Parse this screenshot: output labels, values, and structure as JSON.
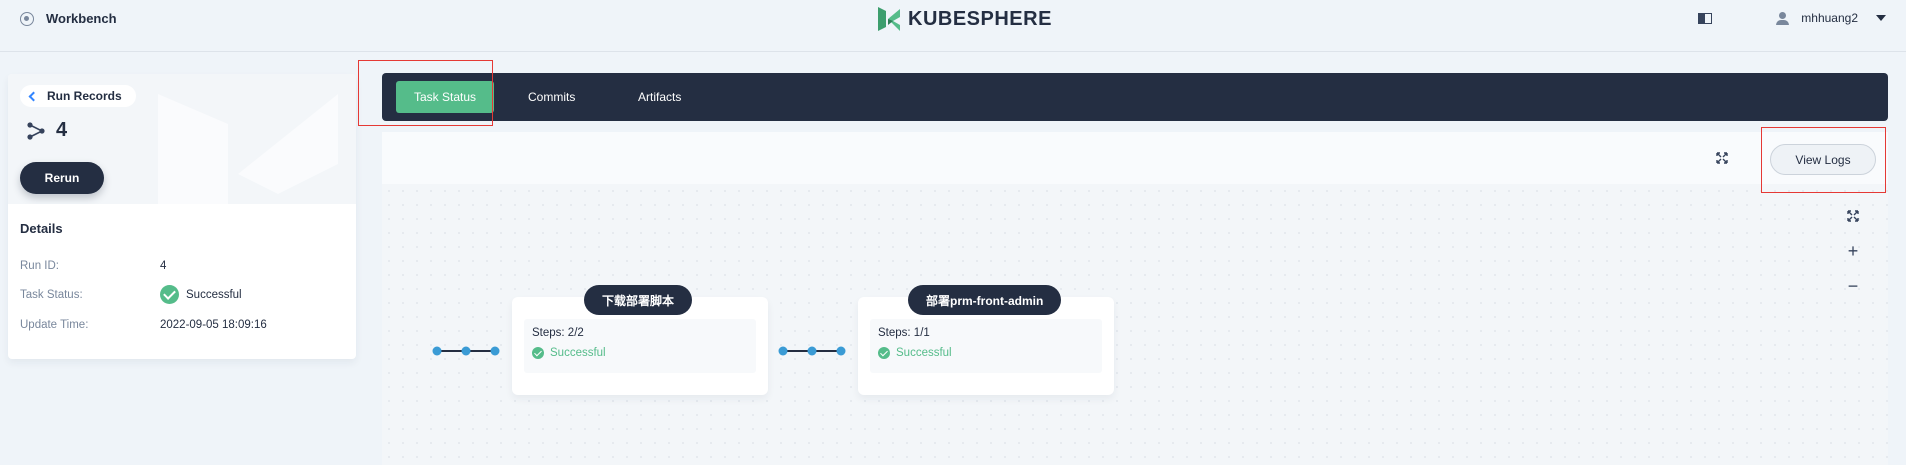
{
  "header": {
    "workbench_label": "Workbench",
    "logo_text": "KUBESPHERE",
    "username": "mhhuang2"
  },
  "run": {
    "back_label": "Run Records",
    "run_number": "4",
    "rerun_label": "Rerun"
  },
  "details": {
    "title": "Details",
    "rows": [
      {
        "key": "Run ID:",
        "value": "4"
      },
      {
        "key": "Task Status:",
        "value": "Successful"
      },
      {
        "key": "Update Time:",
        "value": "2022-09-05 18:09:16"
      }
    ]
  },
  "tabs": [
    {
      "label": "Task Status",
      "active": true
    },
    {
      "label": "Commits",
      "active": false
    },
    {
      "label": "Artifacts",
      "active": false
    }
  ],
  "toolbar": {
    "view_logs_label": "View Logs"
  },
  "zoom": {
    "plus": "+",
    "minus": "−"
  },
  "stages": [
    {
      "name": "下载部署脚本",
      "steps": "Steps: 2/2",
      "status": "Successful"
    },
    {
      "name": "部署prm-front-admin",
      "steps": "Steps: 1/1",
      "status": "Successful"
    }
  ],
  "colors": {
    "accent_green": "#55bc8a",
    "dark": "#242e42",
    "node_blue": "#3a9bd5",
    "highlight_red": "#e53935"
  }
}
